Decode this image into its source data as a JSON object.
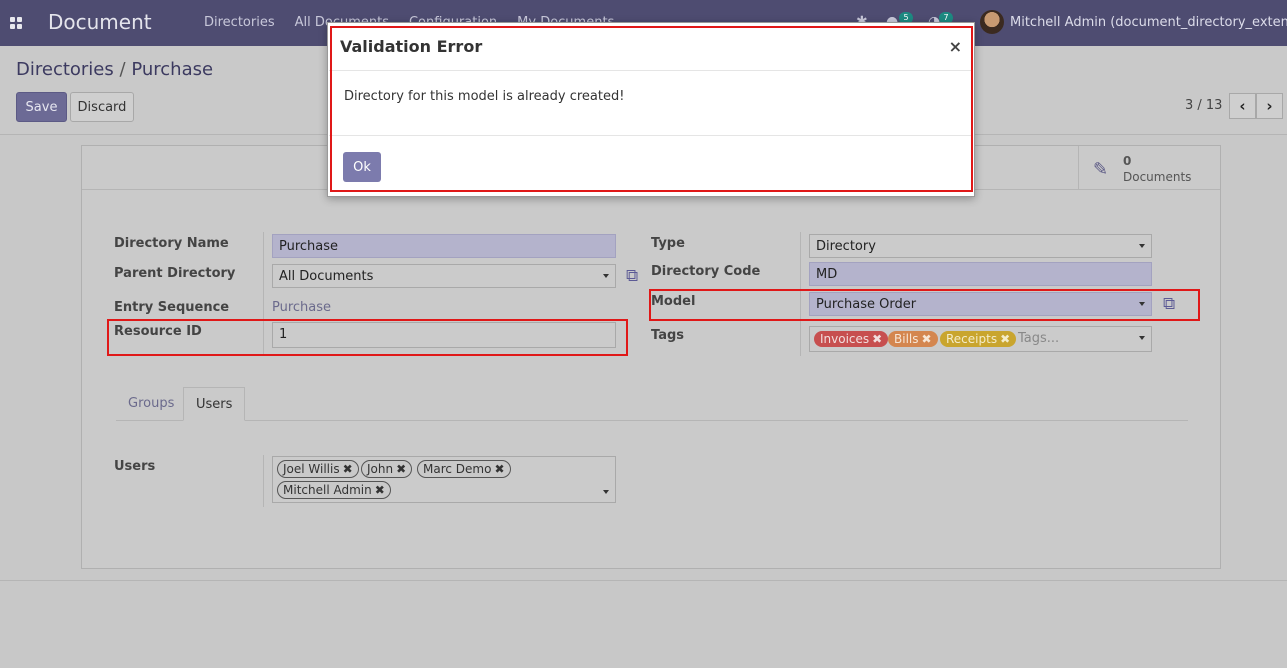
{
  "app": {
    "brand": "Document",
    "menu": [
      "Directories",
      "All Documents",
      "Configuration",
      "My Documents"
    ],
    "badges": {
      "messages": "5",
      "activities": "7"
    },
    "user": "Mitchell Admin (document_directory_extension)"
  },
  "control": {
    "breadcrumb_parent": "Directories",
    "breadcrumb_sep": "/",
    "breadcrumb_current": "Purchase",
    "save_label": "Save",
    "discard_label": "Discard",
    "pager": "3 / 13",
    "prev_icon": "chevron-left-icon",
    "next_icon": "chevron-right-icon"
  },
  "stat": {
    "count": "0",
    "label": "Documents",
    "icon": "edit-icon"
  },
  "form": {
    "directory_name_label": "Directory Name",
    "directory_name": "Purchase",
    "parent_directory_label": "Parent Directory",
    "parent_directory": "All Documents",
    "entry_sequence_label": "Entry Sequence",
    "entry_sequence": "Purchase",
    "resource_id_label": "Resource ID",
    "resource_id": "1",
    "type_label": "Type",
    "type": "Directory",
    "directory_code_label": "Directory Code",
    "directory_code": "MD",
    "model_label": "Model",
    "model": "Purchase Order",
    "tags_label": "Tags",
    "tags": [
      {
        "label": "Invoices",
        "color": "#c74f4f"
      },
      {
        "label": "Bills",
        "color": "#d4864f"
      },
      {
        "label": "Receipts",
        "color": "#c9a52e"
      }
    ],
    "tags_placeholder": "Tags..."
  },
  "tabs": {
    "groups": "Groups",
    "users": "Users"
  },
  "users": {
    "label": "Users",
    "items": [
      "Joel Willis",
      "John",
      "Marc Demo",
      "Mitchell Admin"
    ]
  },
  "dialog": {
    "title": "Validation Error",
    "close": "×",
    "message": "Directory for this model is already created!",
    "ok_label": "Ok"
  },
  "colors": {
    "navbar": "#4e4c71",
    "highlight": "#e01818",
    "primary_button": "#7c7bad"
  }
}
